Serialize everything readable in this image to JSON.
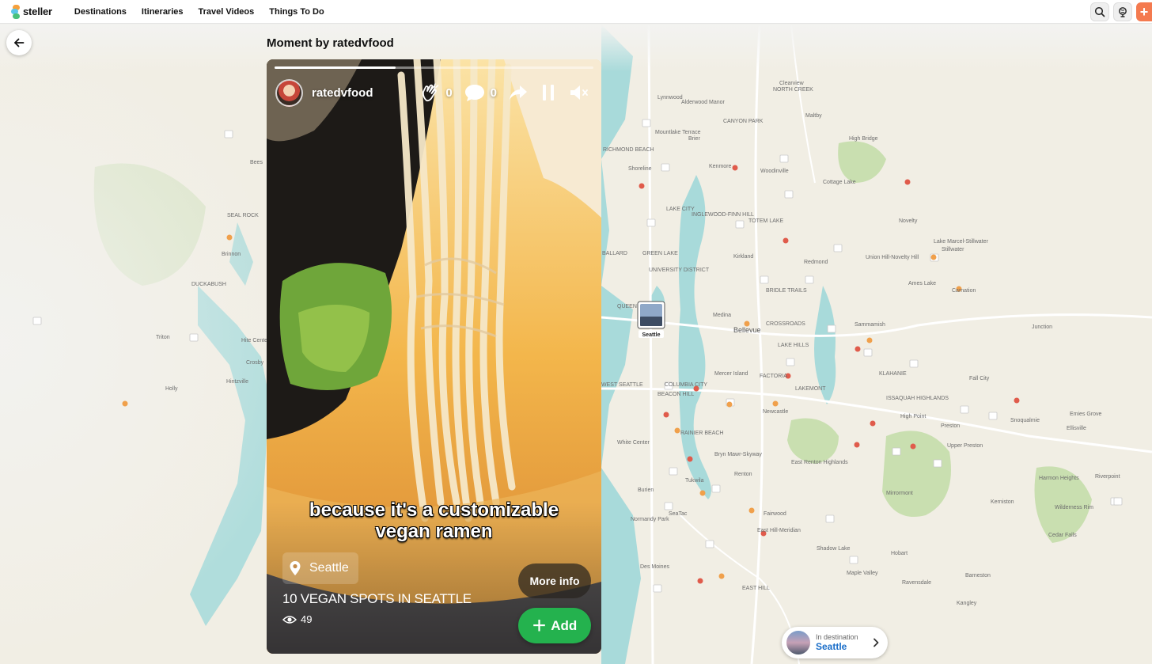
{
  "app": {
    "name": "steller"
  },
  "nav": {
    "links": [
      "Destinations",
      "Itineraries",
      "Travel Videos",
      "Things To Do"
    ]
  },
  "page": {
    "title": "Moment by ratedvfood"
  },
  "story": {
    "author": "ratedvfood",
    "claps": "0",
    "comments": "0",
    "progress": 0.38,
    "caption_line1": "because it's a customizable",
    "caption_line2": "vegan ramen",
    "place": "Seattle",
    "more_info_label": "More info",
    "itinerary_title": "10 VEGAN SPOTS IN SEATTLE",
    "views": "49",
    "add_label": "Add"
  },
  "destination": {
    "kicker": "In destination",
    "name": "Seattle"
  },
  "map": {
    "marker_label": "Seattle",
    "labels": [
      "Clearview",
      "NORTH CREEK",
      "Lynnwood",
      "Alderwood Manor",
      "Maltby",
      "CANYON PARK",
      "RICHMOND BEACH",
      "Mountlake Terrace",
      "Brier",
      "High Bridge",
      "Bees",
      "Shoreline",
      "Kenmore",
      "Woodinville",
      "Cottage Lake",
      "LAKE CITY",
      "INGLEWOOD-FINN HILL",
      "TOTEM LAKE",
      "Novelty",
      "SEAL ROCK",
      "Lake Marcel-Stillwater",
      "Stillwater",
      "Brinnon",
      "BALLARD",
      "GREEN LAKE",
      "Kirkland",
      "Redmond",
      "Union Hill-Novelty Hill",
      "UNIVERSITY DISTRICT",
      "BRIDLE TRAILS",
      "DUCKABUSH",
      "QUEEN ANNE",
      "Medina",
      "Ames Lake",
      "Carnation",
      "Bellevue",
      "CROSSROADS",
      "Sammamish",
      "Junction",
      "Triton",
      "Hite Center",
      "LAKE HILLS",
      "Crosby",
      "Hintzville",
      "KLAHANIE",
      "WEST SEATTLE",
      "COLUMBIA CITY",
      "Mercer Island",
      "FACTORIA",
      "Fall City",
      "Holly",
      "BEACON HILL",
      "LAKEMONT",
      "ISSAQUAH HIGHLANDS",
      "Newcastle",
      "High Point",
      "Snoqualmie",
      "Emies Grove",
      "Ellisville",
      "White Center",
      "RAINIER BEACH",
      "Preston",
      "Upper Preston",
      "Bryn Mawr-Skyway",
      "East Renton Highlands",
      "Renton",
      "Riverpoint",
      "Tukwila",
      "Harmon Heights",
      "Mirrormont",
      "Burien",
      "Kerniston",
      "SeaTac",
      "Wilderness Rim",
      "Normandy Park",
      "Fairwood",
      "East Hill-Meridian",
      "Cedar Falls",
      "Shadow Lake",
      "Hobart",
      "Des Moines",
      "Maple Valley",
      "Barneston",
      "EAST HILL",
      "Ravensdale",
      "Kangley"
    ]
  },
  "icons": {
    "back": "arrow-left-icon",
    "search": "search-icon",
    "globe": "globe-icon",
    "clap": "clap-hands-icon",
    "comment": "speech-bubble-icon",
    "share": "share-arrow-icon",
    "pause": "pause-icon",
    "mute": "speaker-muted-icon",
    "pin": "map-pin-icon",
    "eye": "eye-icon",
    "chevron": "chevron-right-icon"
  },
  "colors": {
    "accent_orange": "#f47a4f",
    "add_green": "#24b24e",
    "water": "#a8dada",
    "link_blue": "#1a6ec9"
  }
}
